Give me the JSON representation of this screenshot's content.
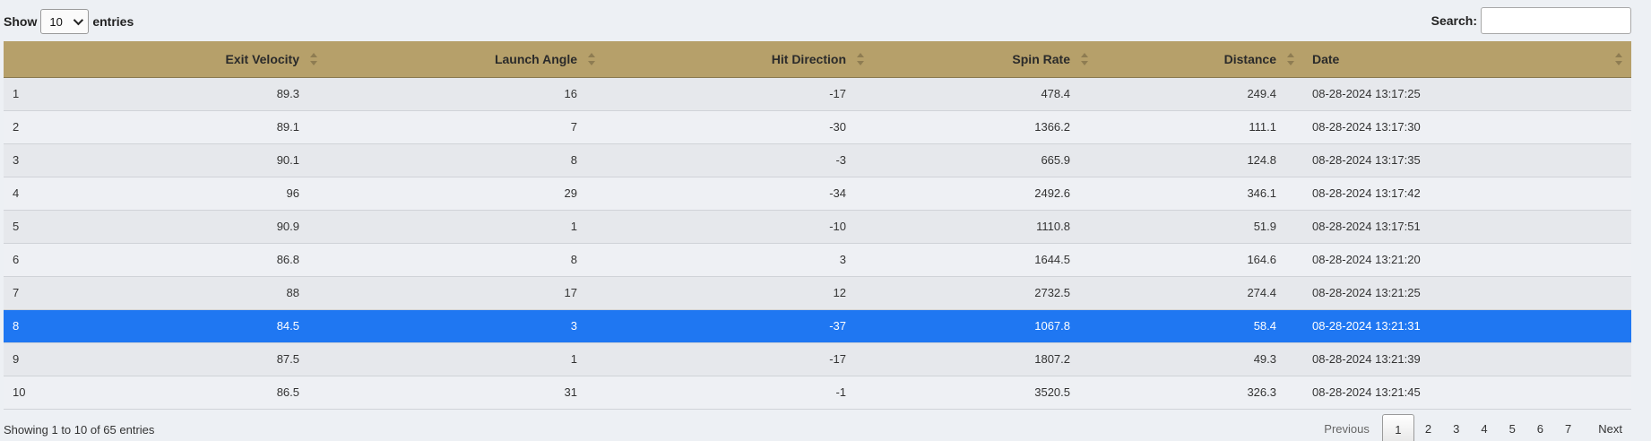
{
  "length_menu": {
    "show_label": "Show",
    "selected_value": "10",
    "entries_label": "entries"
  },
  "search": {
    "label": "Search:",
    "value": ""
  },
  "columns": [
    {
      "label": ""
    },
    {
      "label": "Exit Velocity"
    },
    {
      "label": "Launch Angle"
    },
    {
      "label": "Hit Direction"
    },
    {
      "label": "Spin Rate"
    },
    {
      "label": "Distance"
    },
    {
      "label": "Date"
    }
  ],
  "rows": [
    [
      "1",
      "89.3",
      "16",
      "-17",
      "478.4",
      "249.4",
      "08-28-2024 13:17:25"
    ],
    [
      "2",
      "89.1",
      "7",
      "-30",
      "1366.2",
      "111.1",
      "08-28-2024 13:17:30"
    ],
    [
      "3",
      "90.1",
      "8",
      "-3",
      "665.9",
      "124.8",
      "08-28-2024 13:17:35"
    ],
    [
      "4",
      "96",
      "29",
      "-34",
      "2492.6",
      "346.1",
      "08-28-2024 13:17:42"
    ],
    [
      "5",
      "90.9",
      "1",
      "-10",
      "1110.8",
      "51.9",
      "08-28-2024 13:17:51"
    ],
    [
      "6",
      "86.8",
      "8",
      "3",
      "1644.5",
      "164.6",
      "08-28-2024 13:21:20"
    ],
    [
      "7",
      "88",
      "17",
      "12",
      "2732.5",
      "274.4",
      "08-28-2024 13:21:25"
    ],
    [
      "8",
      "84.5",
      "3",
      "-37",
      "1067.8",
      "58.4",
      "08-28-2024 13:21:31"
    ],
    [
      "9",
      "87.5",
      "1",
      "-17",
      "1807.2",
      "49.3",
      "08-28-2024 13:21:39"
    ],
    [
      "10",
      "86.5",
      "31",
      "-1",
      "3520.5",
      "326.3",
      "08-28-2024 13:21:45"
    ]
  ],
  "selected_row_index": 7,
  "info": "Showing 1 to 10 of 65 entries",
  "pagination": {
    "previous": "Previous",
    "pages": [
      "1",
      "2",
      "3",
      "4",
      "5",
      "6",
      "7"
    ],
    "current": "1",
    "next": "Next"
  },
  "colors": {
    "header_bg": "#b6a06a",
    "selected_row": "#1f77f2",
    "page_bg": "#edf0f4"
  }
}
